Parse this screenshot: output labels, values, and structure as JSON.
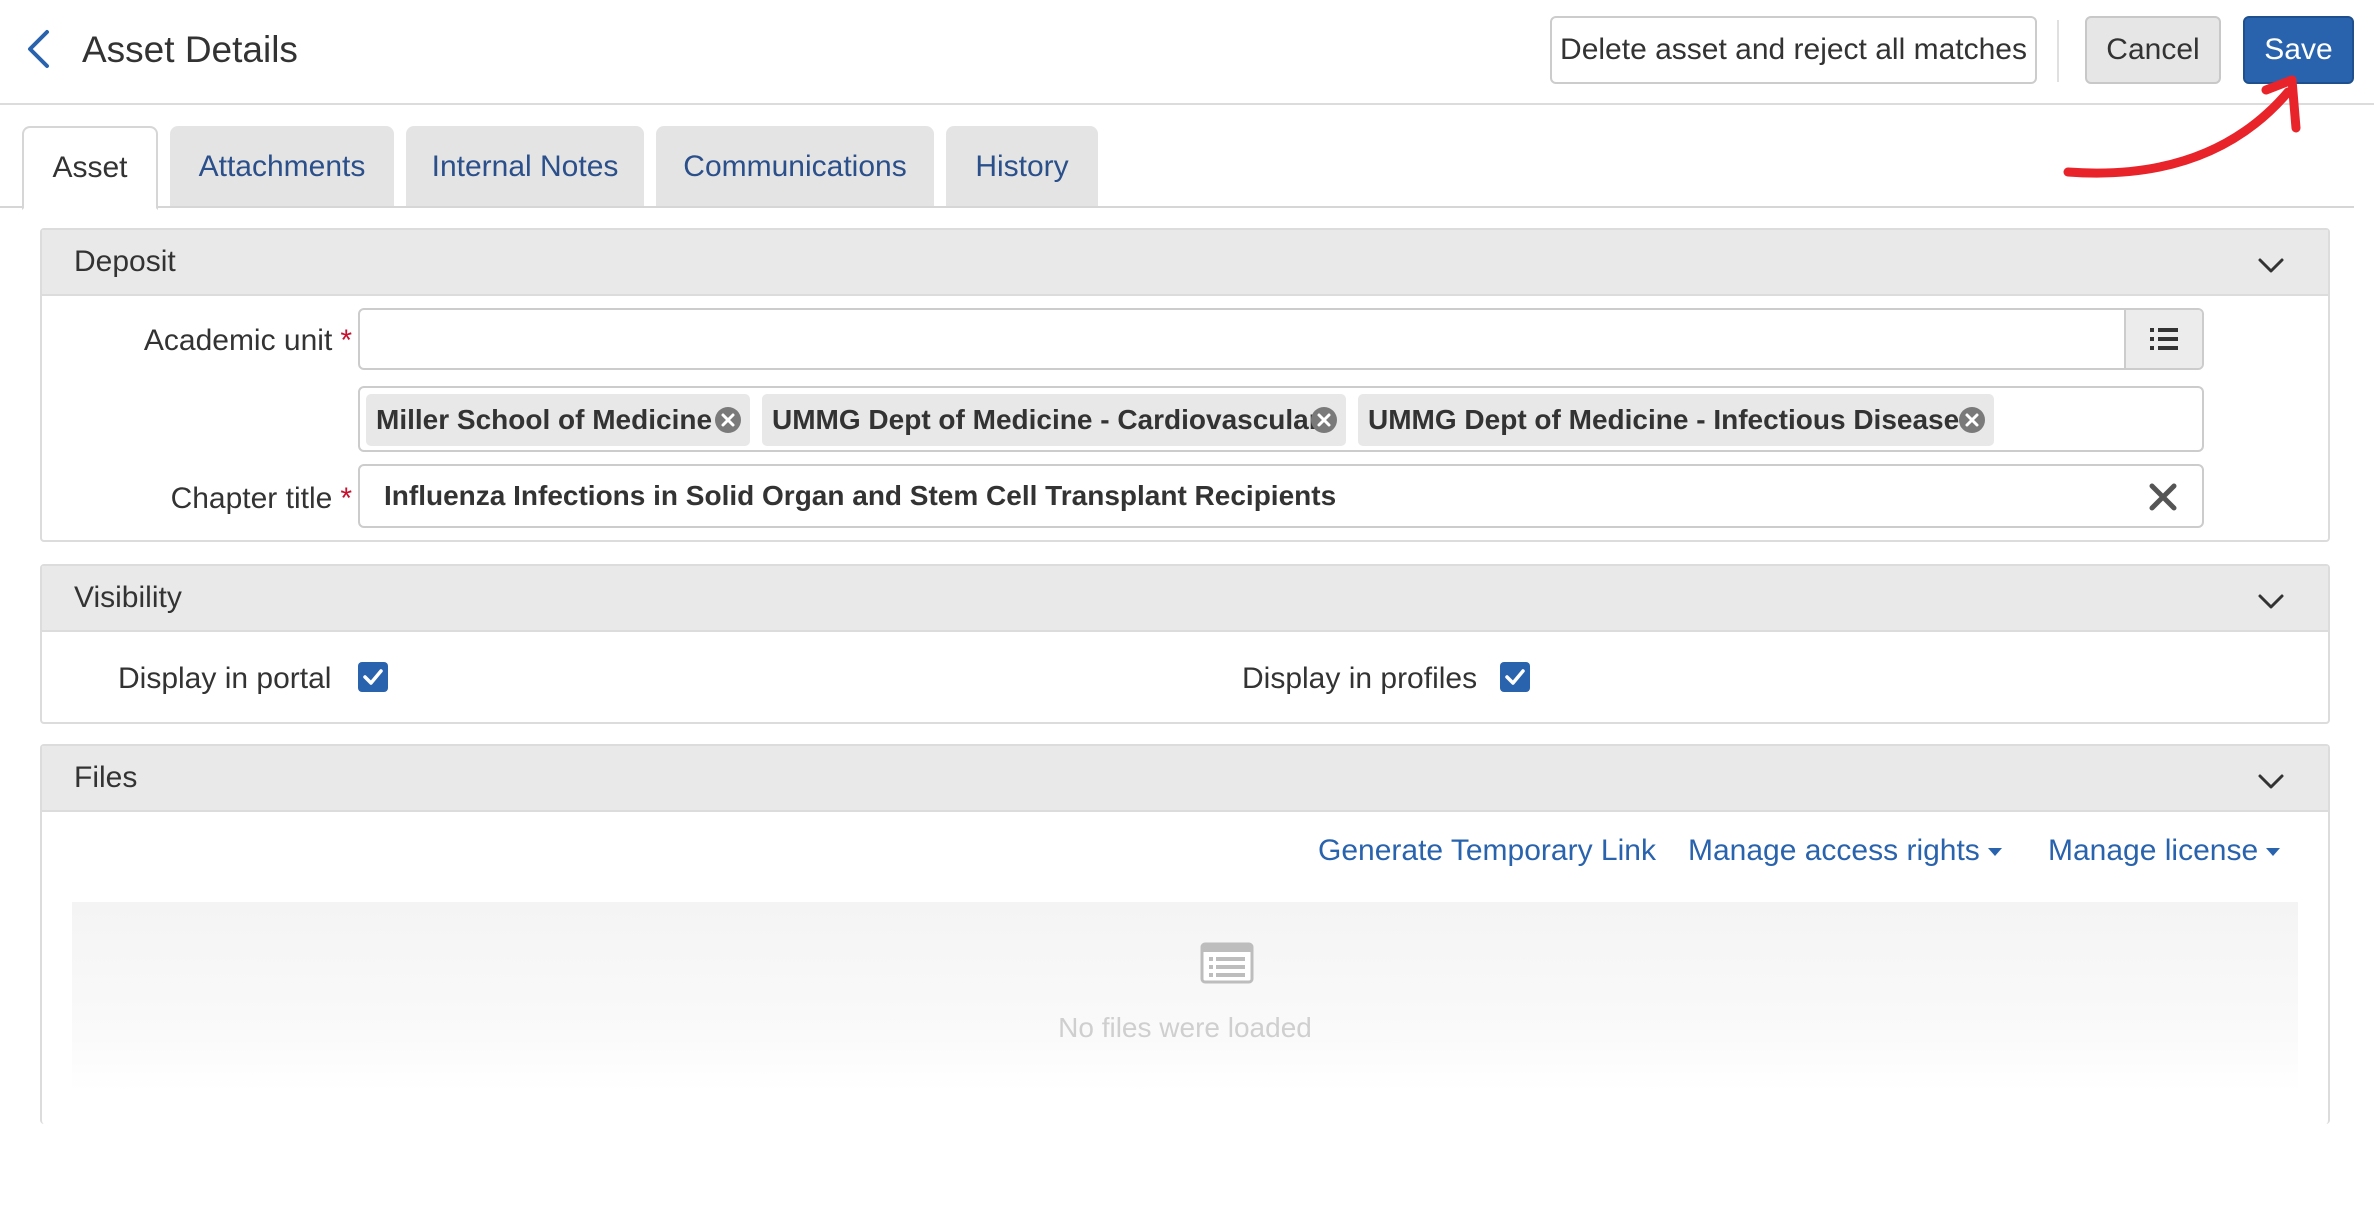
{
  "header": {
    "title": "Asset Details",
    "delete_label": "Delete asset and reject all matches",
    "cancel_label": "Cancel",
    "save_label": "Save"
  },
  "tabs": [
    {
      "label": "Asset",
      "active": true
    },
    {
      "label": "Attachments",
      "active": false
    },
    {
      "label": "Internal Notes",
      "active": false
    },
    {
      "label": "Communications",
      "active": false
    },
    {
      "label": "History",
      "active": false
    }
  ],
  "deposit": {
    "title": "Deposit",
    "academic_unit_label": "Academic unit",
    "academic_unit_value": "",
    "required_mark": "*",
    "chips": [
      "Miller School of Medicine",
      "UMMG Dept of Medicine - Cardiovascular",
      "UMMG Dept of Medicine - Infectious Diseases"
    ],
    "chapter_title_label": "Chapter title",
    "chapter_title_value": "Influenza Infections in Solid Organ and Stem Cell Transplant Recipients"
  },
  "visibility": {
    "title": "Visibility",
    "display_in_portal_label": "Display in portal",
    "display_in_portal_checked": true,
    "display_in_profiles_label": "Display in profiles",
    "display_in_profiles_checked": true
  },
  "files": {
    "title": "Files",
    "generate_link_label": "Generate Temporary Link",
    "manage_access_label": "Manage access rights",
    "manage_license_label": "Manage license",
    "empty_text": "No files were loaded"
  },
  "colors": {
    "accent": "#2a63ad",
    "link": "#2a4f8a",
    "required": "#c8102e",
    "annotation": "#e8232a"
  }
}
